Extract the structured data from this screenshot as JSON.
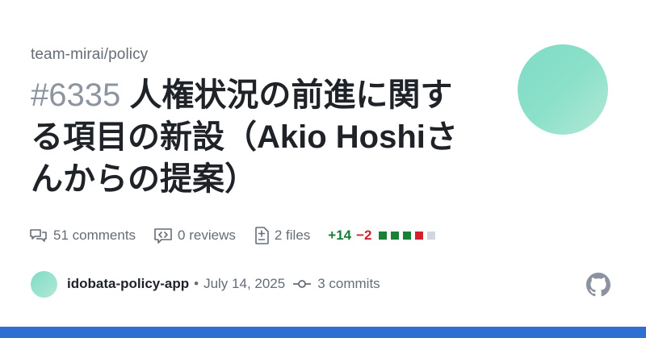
{
  "repo": "team-mirai/policy",
  "pr": {
    "number": "#6335",
    "title": "人権状況の前進に関する項目の新設（Akio Hoshiさんからの提案）"
  },
  "stats": {
    "comments": "51 comments",
    "reviews": "0 reviews",
    "files": "2 files",
    "additions": "+14",
    "deletions": "−2",
    "diffbar": [
      "add",
      "add",
      "add",
      "del",
      "neutral"
    ]
  },
  "meta": {
    "author": "idobata-policy-app",
    "bullet": "•",
    "date": "July 14, 2025",
    "commits": "3 commits"
  },
  "colors": {
    "accent_bar": "#2f6fd1",
    "additions": "#1a7f37",
    "deletions": "#cf222e",
    "neutral": "#d0d7de",
    "avatar": "#8be0c9"
  },
  "icons": [
    "comment-icon",
    "code-review-icon",
    "file-diff-icon",
    "git-commit-icon",
    "github-logo-icon"
  ]
}
